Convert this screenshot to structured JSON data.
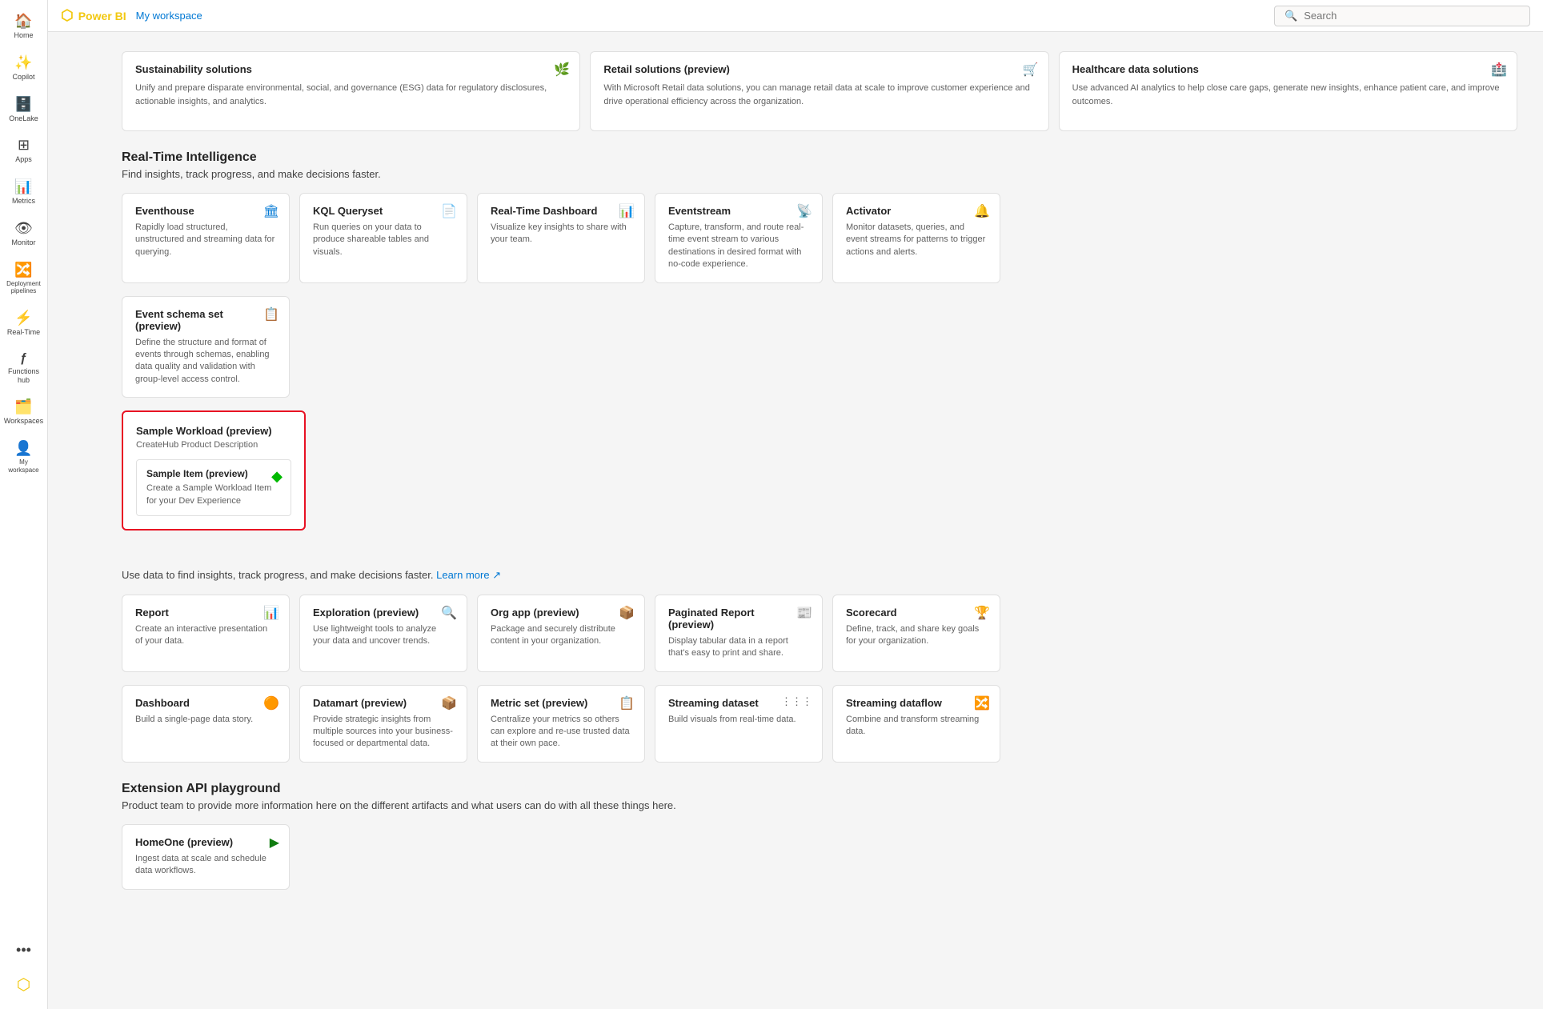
{
  "topbar": {
    "logo": "Power BI",
    "workspace": "My workspace",
    "search_placeholder": "Search"
  },
  "sidebar": {
    "items": [
      {
        "label": "Home",
        "icon": "🏠"
      },
      {
        "label": "Copilot",
        "icon": "✨"
      },
      {
        "label": "OneLake",
        "icon": "🗄️"
      },
      {
        "label": "Apps",
        "icon": "📱"
      },
      {
        "label": "Metrics",
        "icon": "📊"
      },
      {
        "label": "Monitor",
        "icon": "👁"
      },
      {
        "label": "Deployment pipelines",
        "icon": "🔀"
      },
      {
        "label": "Real-Time",
        "icon": "⚡"
      },
      {
        "label": "Functions hub",
        "icon": "ƒ"
      },
      {
        "label": "Workspaces",
        "icon": "🗂️"
      },
      {
        "label": "My workspace",
        "icon": "👤"
      }
    ]
  },
  "top_section": {
    "cards": [
      {
        "title": "Sustainability solutions",
        "desc": "Unify and prepare disparate environmental, social, and governance (ESG) data for regulatory disclosures, actionable insights, and analytics.",
        "icon": "🌿"
      },
      {
        "title": "Retail solutions (preview)",
        "desc": "With Microsoft Retail data solutions, you can manage retail data at scale to improve customer experience and drive operational efficiency across the organization.",
        "icon": "🛒"
      },
      {
        "title": "Healthcare data solutions",
        "desc": "Use advanced AI analytics to help close care gaps, generate new insights, enhance patient care, and improve outcomes.",
        "icon": "🏥"
      }
    ]
  },
  "real_time_section": {
    "title": "Real-Time Intelligence",
    "desc": "Find insights, track progress, and make decisions faster.",
    "items": [
      {
        "title": "Eventhouse",
        "desc": "Rapidly load structured, unstructured and streaming data for querying.",
        "icon": "🏛"
      },
      {
        "title": "KQL Queryset",
        "desc": "Run queries on your data to produce shareable tables and visuals.",
        "icon": "📄"
      },
      {
        "title": "Real-Time Dashboard",
        "desc": "Visualize key insights to share with your team.",
        "icon": "📊"
      },
      {
        "title": "Eventstream",
        "desc": "Capture, transform, and route real-time event stream to various destinations in desired format with no-code experience.",
        "icon": "📡"
      },
      {
        "title": "Activator",
        "desc": "Monitor datasets, queries, and event streams for patterns to trigger actions and alerts.",
        "icon": "🔔"
      }
    ],
    "row2": [
      {
        "title": "Event schema set (preview)",
        "desc": "Define the structure and format of events through schemas, enabling data quality and validation with group-level access control.",
        "icon": "📋"
      }
    ]
  },
  "sample_workload_section": {
    "title": "Sample Workload (preview)",
    "subtitle": "CreateHub Product Description",
    "highlight": true,
    "items": [
      {
        "title": "Sample Item (preview)",
        "desc": "Create a Sample Workload Item for your Dev Experience",
        "icon": "◆"
      }
    ]
  },
  "use_data_section": {
    "desc": "Use data to find insights, track progress, and make decisions faster.",
    "learn_more": "Learn more",
    "items_row1": [
      {
        "title": "Report",
        "desc": "Create an interactive presentation of your data.",
        "icon": "📊"
      },
      {
        "title": "Exploration (preview)",
        "desc": "Use lightweight tools to analyze your data and uncover trends.",
        "icon": "🔍"
      },
      {
        "title": "Org app (preview)",
        "desc": "Package and securely distribute content in your organization.",
        "icon": "📦"
      },
      {
        "title": "Paginated Report (preview)",
        "desc": "Display tabular data in a report that's easy to print and share.",
        "icon": "📰"
      },
      {
        "title": "Scorecard",
        "desc": "Define, track, and share key goals for your organization.",
        "icon": "🏆"
      }
    ],
    "items_row2": [
      {
        "title": "Dashboard",
        "desc": "Build a single-page data story.",
        "icon": "🟠"
      },
      {
        "title": "Datamart (preview)",
        "desc": "Provide strategic insights from multiple sources into your business-focused or departmental data.",
        "icon": "📦"
      },
      {
        "title": "Metric set (preview)",
        "desc": "Centralize your metrics so others can explore and re-use trusted data at their own pace.",
        "icon": "📋"
      },
      {
        "title": "Streaming dataset",
        "desc": "Build visuals from real-time data.",
        "icon": "⋮⋮⋮"
      },
      {
        "title": "Streaming dataflow",
        "desc": "Combine and transform streaming data.",
        "icon": "🔀"
      }
    ]
  },
  "extension_api_section": {
    "title": "Extension API playground",
    "desc": "Product team to provide more information here on the different artifacts and what users can do with all these things here.",
    "items": [
      {
        "title": "HomeOne (preview)",
        "desc": "Ingest data at scale and schedule data workflows.",
        "icon": "▶"
      }
    ]
  }
}
